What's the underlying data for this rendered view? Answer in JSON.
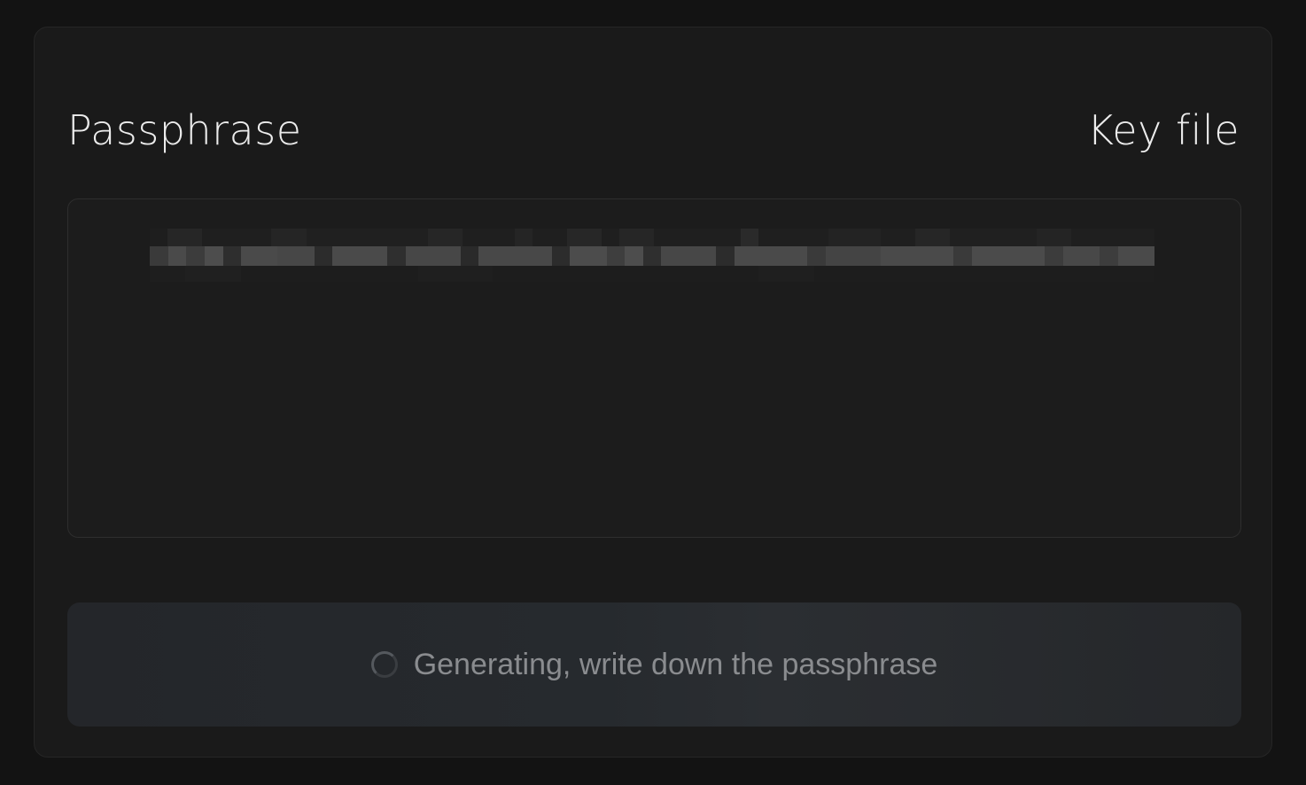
{
  "tabs": {
    "passphrase_label": "Passphrase",
    "keyfile_label": "Key file"
  },
  "phrase": {
    "value": ""
  },
  "generate": {
    "label": "Generating, write down the passphrase",
    "state": "loading"
  },
  "colors": {
    "background": "#131313",
    "panel": "#1a1a1a",
    "text_primary": "#ececec",
    "text_muted": "#8a8c8f"
  }
}
